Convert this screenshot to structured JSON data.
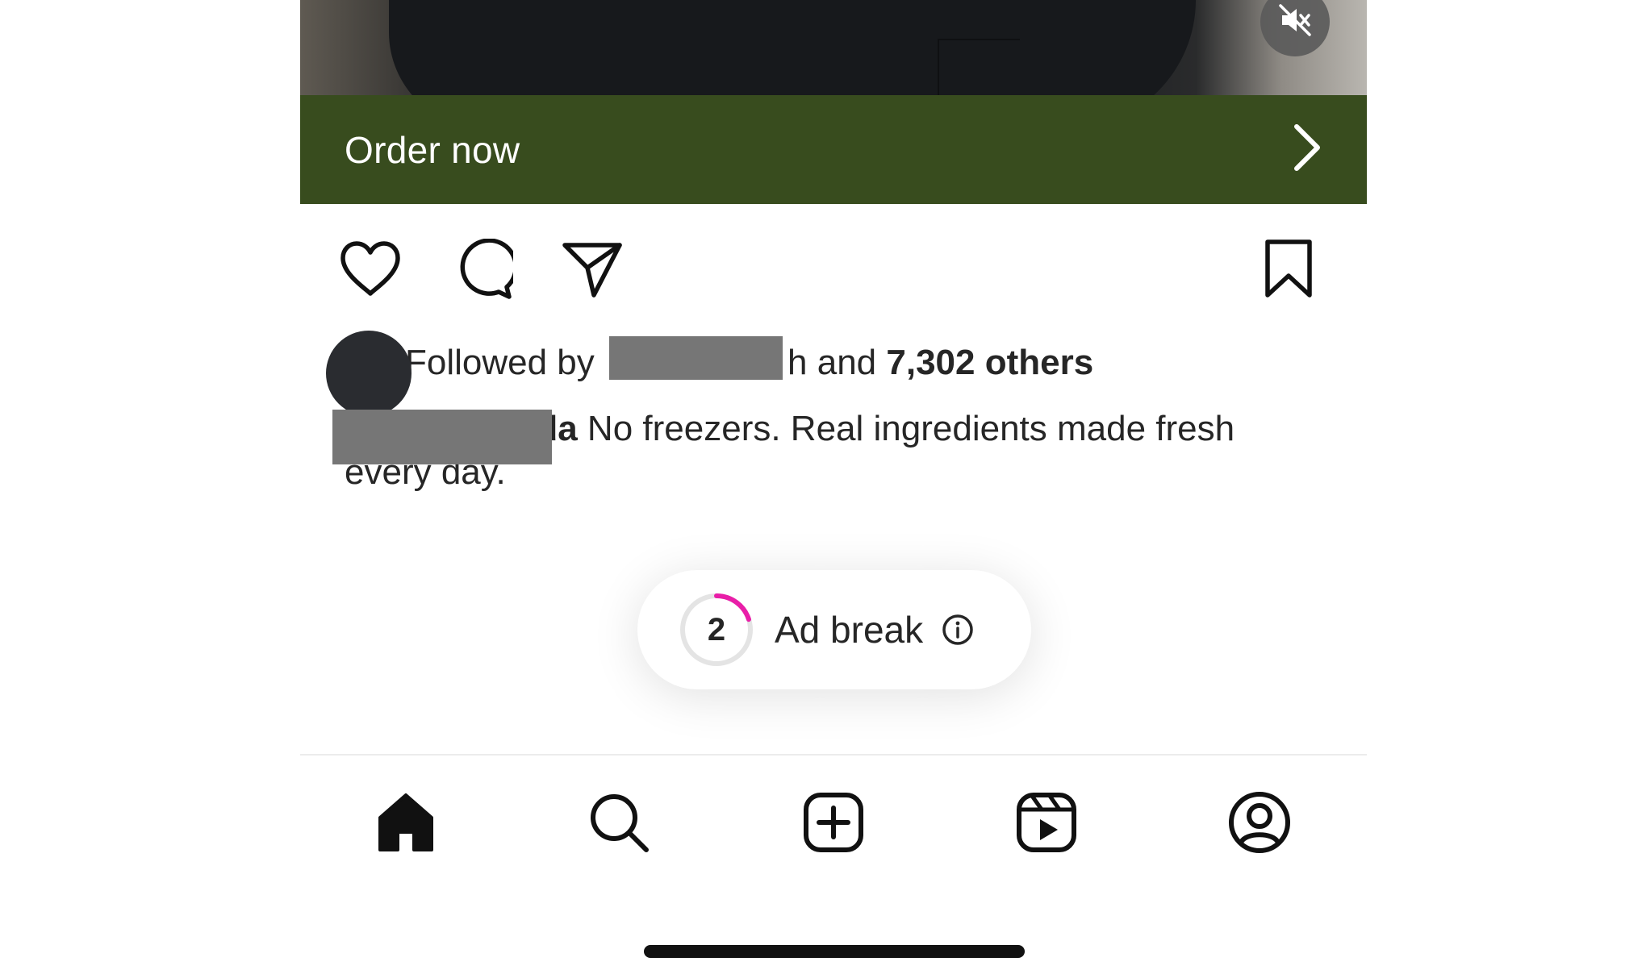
{
  "cta": {
    "label": "Order now",
    "background": "#384c1e"
  },
  "video": {
    "mute_icon": "speaker-muted-icon"
  },
  "actions": {
    "like_icon": "heart-icon",
    "comment_icon": "comment-bubble-icon",
    "share_icon": "paper-plane-icon",
    "save_icon": "bookmark-icon"
  },
  "followed": {
    "prefix": "Followed by ",
    "redacted_tail": "h",
    "middle": " and ",
    "others": "7,302 others"
  },
  "caption": {
    "username_visible": "nada",
    "text": " No freezers. Real ingredients made fresh every day."
  },
  "ad_break": {
    "countdown": "2",
    "label": "Ad break",
    "progress": 0.2,
    "accent": "#e91ea8",
    "info_icon": "info-icon"
  },
  "tabs": [
    {
      "name": "home",
      "icon": "home-icon",
      "active": true
    },
    {
      "name": "search",
      "icon": "search-icon"
    },
    {
      "name": "create",
      "icon": "plus-square-icon"
    },
    {
      "name": "reels",
      "icon": "reels-icon"
    },
    {
      "name": "profile",
      "icon": "profile-icon"
    }
  ]
}
